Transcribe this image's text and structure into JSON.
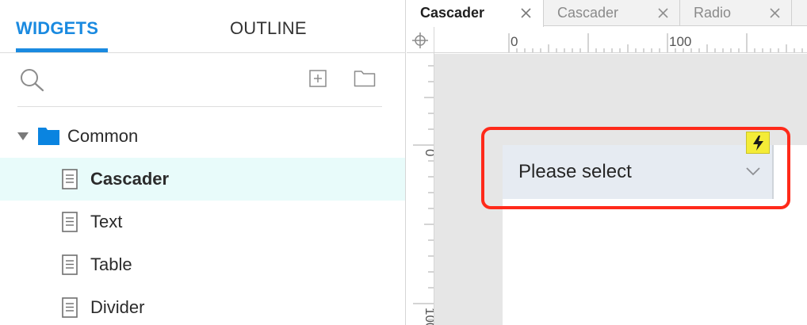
{
  "left_panel": {
    "tabs": [
      {
        "label": "WIDGETS",
        "active": true
      },
      {
        "label": "OUTLINE",
        "active": false
      }
    ],
    "toolbar": {
      "search_icon": "search-icon",
      "add_page_icon": "add-page-icon",
      "add_folder_icon": "add-folder-icon"
    },
    "tree": {
      "folder": {
        "label": "Common",
        "expanded": true,
        "icon": "folder-icon",
        "icon_color": "#0a84e0"
      },
      "items": [
        {
          "label": "Cascader",
          "selected": true,
          "icon": "page-icon"
        },
        {
          "label": "Text",
          "selected": false,
          "icon": "page-icon"
        },
        {
          "label": "Table",
          "selected": false,
          "icon": "page-icon"
        },
        {
          "label": "Divider",
          "selected": false,
          "icon": "page-icon"
        }
      ]
    }
  },
  "doc_tabs": [
    {
      "label": "Cascader",
      "active": true
    },
    {
      "label": "Cascader",
      "active": false
    },
    {
      "label": "Radio",
      "active": false
    }
  ],
  "rulers": {
    "top_labels": [
      "0",
      "100"
    ],
    "left_labels": [
      "0",
      "100"
    ]
  },
  "canvas": {
    "cascader": {
      "placeholder": "Please select",
      "arrow_icon": "chevron-down-icon"
    },
    "event_badge_icon": "lightning-icon"
  },
  "colors": {
    "accent": "#1a8ae0",
    "selected_row": "#e8fbfa",
    "highlight": "#ff2a1a",
    "badge": "#f4ec37",
    "cascader_bg": "#e6ebf2"
  }
}
